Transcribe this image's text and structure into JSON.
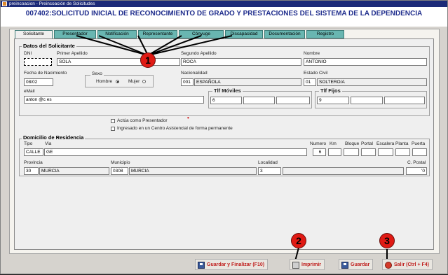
{
  "window": {
    "title": "preincoacion - Preincoación de Solicitudes"
  },
  "header": {
    "title": "007402:SOLICITUD INICIAL DE RECONOCIMIENTO DE GRADO Y PRESTACIONES DEL SISTEMA DE LA DEPENDENCIA"
  },
  "tabs": [
    "Solicitante",
    "Presentador",
    "Notificación",
    "Representante",
    "Cónyuge",
    "Discapacidad",
    "Documentación",
    "Registro"
  ],
  "solicitante": {
    "legend": "Datos del Solicitante",
    "dni_label": "DNI",
    "dni_value": "",
    "apellido1_label": "Primer Apellido",
    "apellido1_value": "SOLA",
    "apellido2_label": "Segundo Apellido",
    "apellido2_value": "ROCA",
    "nombre_label": "Nombre",
    "nombre_value": "ANTONIO",
    "fecha_label": "Fecha de Nacimiento",
    "fecha_value": "08/02",
    "sexo_label": "Sexo",
    "hombre_label": "Hombre",
    "mujer_label": "Mujer",
    "nacionalidad_label": "Nacionalidad",
    "nacionalidad_code": "001",
    "nacionalidad_value": "ESPAÑOLA",
    "civil_label": "Estado Civil",
    "civil_code": "01",
    "civil_value": "SOLTERO/A",
    "email_label": "eMail",
    "email_value": "anton       @c        es",
    "moviles_label": "Tlf Móviles",
    "movil1": "6",
    "fijos_label": "Tlf Fijos",
    "fijo1": "9",
    "actua_label": "Actúa como Presentador",
    "ingresado_label": "Ingresado en un Centro Asistencial de forma permanente"
  },
  "domicilio": {
    "legend": "Domicilio de Residencia",
    "tipo_label": "Tipo",
    "tipo_value": "CALLE",
    "via_label": "Via",
    "via_value": "GE",
    "numero_label": "Numero",
    "numero_value": "6",
    "km_label": "Km",
    "bloque_label": "Bloque",
    "portal_label": "Portal",
    "escalera_label": "Escalera",
    "planta_label": "Planta",
    "puerta_label": "Puerta",
    "provincia_label": "Provincia",
    "provincia_code": "30",
    "provincia_value": "MURCIA",
    "municipio_label": "Municipio",
    "municipio_code": "0308",
    "municipio_value": "MURCIA",
    "localidad_label": "Localidad",
    "localidad_value": "3",
    "cpostal_label": "C. Postal",
    "cpostal_value": "'0"
  },
  "footer": {
    "guardar_finalizar": "Guardar y Finalizar (F10)",
    "imprimir": "Imprimir",
    "guardar": "Guardar",
    "salir": "Salir (Ctrl + F4)"
  },
  "callouts": [
    "1",
    "2",
    "3"
  ],
  "colors": {
    "title": "#1e2c8c",
    "tab": "#69b6b1",
    "callout": "#e01a14",
    "footer_text": "#c0201e",
    "titlebar": "#1c2a78"
  }
}
